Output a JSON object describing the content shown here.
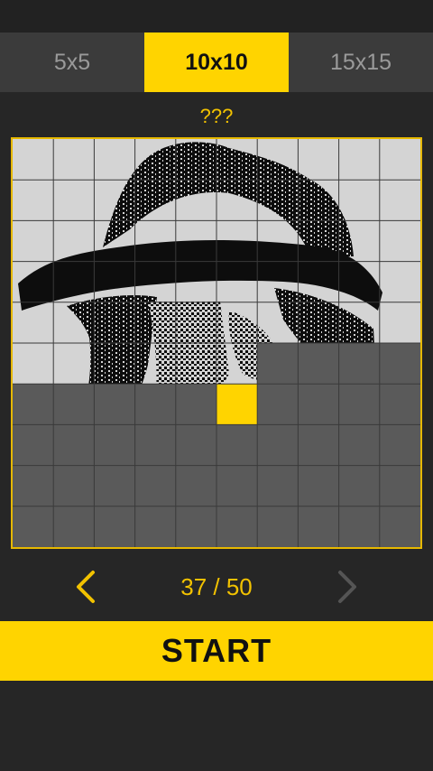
{
  "tabs": [
    {
      "label": "5x5",
      "active": false
    },
    {
      "label": "10x10",
      "active": true
    },
    {
      "label": "15x15",
      "active": false
    }
  ],
  "puzzle": {
    "title": "???",
    "grid_size": 10,
    "solved_cells": 56,
    "current_cell": {
      "row": 6,
      "col": 5
    }
  },
  "navigation": {
    "counter": "37 / 50",
    "prev_icon": "chevron-left-icon",
    "next_icon": "chevron-right-icon",
    "prev_enabled": true,
    "next_enabled": false
  },
  "start_label": "START",
  "colors": {
    "accent": "#ffd400",
    "background": "#262626",
    "tab_bar": "#3b3b3b",
    "board_light": "#d4d4d4",
    "unsolved": "#5a5a5a",
    "arrow_enabled": "#f2c200",
    "arrow_disabled": "#555555"
  }
}
